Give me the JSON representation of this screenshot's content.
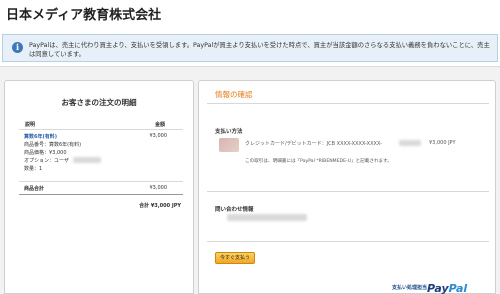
{
  "header": {
    "merchant_name": "日本メディア教育株式会社"
  },
  "notice": {
    "icon": "info-icon",
    "text": "PayPalは、売主に代わり買主より、支払いを受領します。PayPalが買主より支払いを受けた時点で、買主が当該金額のさらなる支払い義務を負わないことに、売主は同意しています。"
  },
  "order_summary": {
    "title": "お客さまの注文の明細",
    "columns": {
      "description": "説明",
      "amount": "金額"
    },
    "item": {
      "name": "算数6年(有料)",
      "price": "¥3,000",
      "details": [
        "商品番号：算数6年(有料)",
        "商品価格：¥3,000",
        "オプション：ユーザ",
        "数量：1"
      ]
    },
    "subtotal_label": "商品合計",
    "subtotal_value": "¥3,000",
    "total": "合計 ¥3,000 JPY"
  },
  "confirmation": {
    "heading": "情報の確認",
    "payment_method_label": "支払い方法",
    "card_text": "クレジットカード/デビットカード：JCB XXXX-XXXX-XXXX-",
    "card_amount": "¥3,000 JPY",
    "statement_note": "この取引は、明細書には「PayPal *RIBENMEDE-U」と記載されます。",
    "contact_label": "問い合わせ情報",
    "pay_button_label": "今すぐ支払う",
    "handled_by": "支払い処理担当",
    "paypal_logo": {
      "pay": "Pay",
      "pal": "Pal"
    }
  },
  "colors": {
    "accent_orange": "#e07d14",
    "link_blue": "#2a5da8",
    "notice_bg": "#e7f0f9",
    "button_gold": "#f2a72a"
  }
}
